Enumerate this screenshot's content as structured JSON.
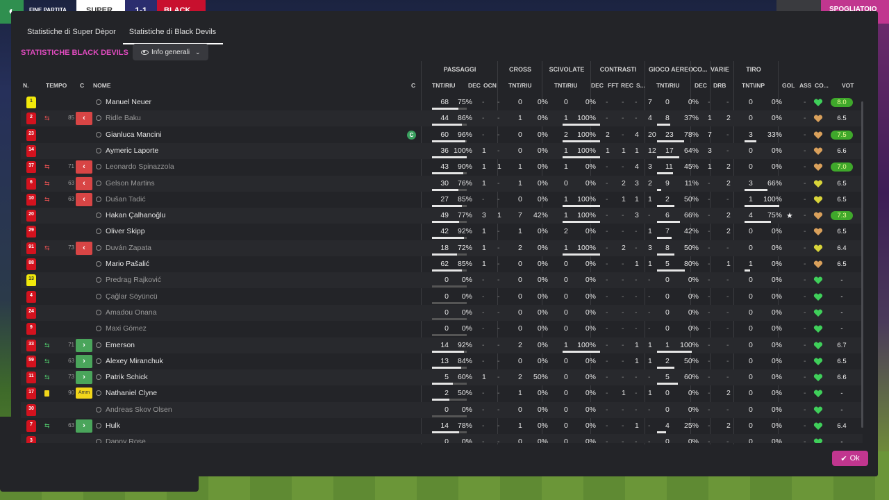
{
  "topbar": {
    "result_label": "FINE PARTITA",
    "team_home": "SUPER",
    "score": "1-1",
    "team_away": "BLACK",
    "dressing_room": "SPOGLIATOIO"
  },
  "tabs": [
    "Statistiche di Super Dèpor",
    "Statistiche di Black Devils"
  ],
  "section_title": "STATISTICHE BLACK DEVILS",
  "dropdown": "Info generali",
  "groups": [
    "PASSAGGI",
    "CROSS",
    "SCIVOLATE",
    "CONTRASTI",
    "GIOCO AEREO",
    "CO...",
    "VARIE",
    "TIRO"
  ],
  "cols": {
    "n": "N.",
    "tempo": "TEMPO",
    "c": "C",
    "nome": "NOME",
    "c2": "C",
    "pass": "TNT/RIU",
    "pdec": "DEC",
    "pocn": "OCN",
    "cross": "TNT/RIU",
    "sciv": "TNT/RIU",
    "cdec": "DEC",
    "cfft": "FFT",
    "crec": "REC",
    "cs": "S...",
    "aereo": "TNT/RIU",
    "codec": "DEC",
    "drb": "DRB",
    "tiro": "TNT\\INP",
    "gol": "GOL",
    "ass": "ASS",
    "co": "CO...",
    "vot": "VOT"
  },
  "players": [
    {
      "num": "1",
      "kit": "yellow",
      "name": "Manuel Neuer",
      "p": [
        "68",
        "75%"
      ],
      "pb": 0.75,
      "pd": "-",
      "po": "-",
      "c": [
        "0",
        "0%"
      ],
      "s": [
        "0",
        "0%"
      ],
      "cd": "-",
      "cf": "-",
      "cr": "-",
      "cs": "7",
      "a": [
        "0",
        "0%"
      ],
      "ad": "-",
      "dr": "-",
      "t": [
        "0",
        "0%"
      ],
      "gl": "",
      "as": "-",
      "mood": "green",
      "vot": "8.0",
      "vg": true
    },
    {
      "num": "2",
      "kit": "red",
      "sub": "out",
      "min": "85",
      "name": "Ridle Baku",
      "dim": true,
      "p": [
        "44",
        "86%"
      ],
      "pb": 0.86,
      "pd": "-",
      "po": "-",
      "c": [
        "1",
        "0%"
      ],
      "s": [
        "1",
        "100%"
      ],
      "cd": "-",
      "cf": "-",
      "cr": "-",
      "cs": "4",
      "a": [
        "8",
        "37%"
      ],
      "ad": "1",
      "dr": "2",
      "t": [
        "0",
        "0%"
      ],
      "gl": "",
      "as": "-",
      "mood": "orange",
      "vot": "6.5",
      "vg": false
    },
    {
      "num": "23",
      "kit": "red",
      "name": "Gianluca Mancini",
      "cap": true,
      "p": [
        "60",
        "96%"
      ],
      "pb": 0.96,
      "pd": "-",
      "po": "-",
      "c": [
        "0",
        "0%"
      ],
      "s": [
        "2",
        "100%"
      ],
      "cd": "2",
      "cf": "-",
      "cr": "4",
      "cs": "20",
      "a": [
        "23",
        "78%"
      ],
      "ad": "7",
      "dr": "-",
      "t": [
        "3",
        "33%"
      ],
      "gl": "",
      "as": "-",
      "mood": "orange",
      "vot": "7.5",
      "vg": true
    },
    {
      "num": "14",
      "kit": "red",
      "name": "Aymeric Laporte",
      "p": [
        "36",
        "100%"
      ],
      "pb": 1,
      "pd": "1",
      "po": "-",
      "c": [
        "0",
        "0%"
      ],
      "s": [
        "1",
        "100%"
      ],
      "cd": "1",
      "cf": "1",
      "cr": "1",
      "cs": "12",
      "a": [
        "17",
        "64%"
      ],
      "ad": "3",
      "dr": "-",
      "t": [
        "0",
        "0%"
      ],
      "gl": "",
      "as": "-",
      "mood": "orange",
      "vot": "6.6",
      "vg": false
    },
    {
      "num": "37",
      "kit": "red",
      "sub": "out",
      "min": "71",
      "name": "Leonardo Spinazzola",
      "dim": true,
      "p": [
        "43",
        "90%"
      ],
      "pb": 0.9,
      "pd": "1",
      "po": "1",
      "c": [
        "1",
        "0%"
      ],
      "s": [
        "1",
        "0%"
      ],
      "cd": "-",
      "cf": "-",
      "cr": "4",
      "cs": "3",
      "a": [
        "11",
        "45%"
      ],
      "ad": "1",
      "dr": "2",
      "t": [
        "0",
        "0%"
      ],
      "gl": "",
      "as": "-",
      "mood": "orange",
      "vot": "7.0",
      "vg": true
    },
    {
      "num": "6",
      "kit": "red",
      "sub": "out",
      "min": "63",
      "name": "Gelson Martins",
      "dim": true,
      "p": [
        "30",
        "76%"
      ],
      "pb": 0.76,
      "pd": "1",
      "po": "-",
      "c": [
        "1",
        "0%"
      ],
      "s": [
        "0",
        "0%"
      ],
      "cd": "-",
      "cf": "2",
      "cr": "3",
      "cs": "2",
      "a": [
        "9",
        "11%"
      ],
      "ad": "-",
      "dr": "2",
      "t": [
        "3",
        "66%"
      ],
      "gl": "",
      "as": "-",
      "mood": "yellow",
      "vot": "6.5",
      "vg": false
    },
    {
      "num": "10",
      "kit": "red",
      "sub": "out",
      "min": "63",
      "name": "Dušan Tadić",
      "dim": true,
      "p": [
        "27",
        "85%"
      ],
      "pb": 0.85,
      "pd": "-",
      "po": "-",
      "c": [
        "0",
        "0%"
      ],
      "s": [
        "1",
        "100%"
      ],
      "cd": "-",
      "cf": "1",
      "cr": "1",
      "cs": "1",
      "a": [
        "2",
        "50%"
      ],
      "ad": "-",
      "dr": "-",
      "t": [
        "1",
        "100%"
      ],
      "gl": "",
      "as": "-",
      "mood": "yellow",
      "vot": "6.5",
      "vg": false
    },
    {
      "num": "20",
      "kit": "red",
      "name": "Hakan Çalhanoğlu",
      "p": [
        "49",
        "77%"
      ],
      "pb": 0.77,
      "pd": "3",
      "po": "1",
      "c": [
        "7",
        "42%"
      ],
      "s": [
        "1",
        "100%"
      ],
      "cd": "-",
      "cf": "-",
      "cr": "3",
      "cs": "-",
      "a": [
        "6",
        "66%"
      ],
      "ad": "-",
      "dr": "2",
      "t": [
        "4",
        "75%"
      ],
      "gl": "★",
      "as": "-",
      "mood": "orange",
      "vot": "7.3",
      "vg": true
    },
    {
      "num": "29",
      "kit": "red",
      "name": "Oliver Skipp",
      "p": [
        "42",
        "92%"
      ],
      "pb": 0.92,
      "pd": "1",
      "po": "-",
      "c": [
        "1",
        "0%"
      ],
      "s": [
        "2",
        "0%"
      ],
      "cd": "-",
      "cf": "-",
      "cr": "-",
      "cs": "1",
      "a": [
        "7",
        "42%"
      ],
      "ad": "-",
      "dr": "2",
      "t": [
        "0",
        "0%"
      ],
      "gl": "",
      "as": "-",
      "mood": "orange",
      "vot": "6.5",
      "vg": false
    },
    {
      "num": "91",
      "kit": "red",
      "sub": "out",
      "min": "73",
      "name": "Duván Zapata",
      "dim": true,
      "p": [
        "18",
        "72%"
      ],
      "pb": 0.72,
      "pd": "1",
      "po": "-",
      "c": [
        "2",
        "0%"
      ],
      "s": [
        "1",
        "100%"
      ],
      "cd": "-",
      "cf": "2",
      "cr": "-",
      "cs": "3",
      "a": [
        "8",
        "50%"
      ],
      "ad": "-",
      "dr": "-",
      "t": [
        "0",
        "0%"
      ],
      "gl": "",
      "as": "-",
      "mood": "yellow",
      "vot": "6.4",
      "vg": false
    },
    {
      "num": "88",
      "kit": "red",
      "name": "Mario Pašalić",
      "p": [
        "62",
        "85%"
      ],
      "pb": 0.85,
      "pd": "1",
      "po": "-",
      "c": [
        "0",
        "0%"
      ],
      "s": [
        "0",
        "0%"
      ],
      "cd": "-",
      "cf": "-",
      "cr": "1",
      "cs": "1",
      "a": [
        "5",
        "80%"
      ],
      "ad": "-",
      "dr": "1",
      "t": [
        "1",
        "0%"
      ],
      "gl": "",
      "as": "-",
      "mood": "orange",
      "vot": "6.5",
      "vg": false
    },
    {
      "num": "13",
      "kit": "yellow",
      "name": "Predrag Rajković",
      "dim": true,
      "p": [
        "0",
        "0%"
      ],
      "pb": 0,
      "pd": "-",
      "po": "-",
      "c": [
        "0",
        "0%"
      ],
      "s": [
        "0",
        "0%"
      ],
      "cd": "-",
      "cf": "-",
      "cr": "-",
      "cs": "-",
      "a": [
        "0",
        "0%"
      ],
      "ad": "-",
      "dr": "-",
      "t": [
        "0",
        "0%"
      ],
      "gl": "",
      "as": "-",
      "mood": "green",
      "vot": "-",
      "vg": false
    },
    {
      "num": "4",
      "kit": "red",
      "name": "Çağlar Söyüncü",
      "dim": true,
      "p": [
        "0",
        "0%"
      ],
      "pb": 0,
      "pd": "-",
      "po": "-",
      "c": [
        "0",
        "0%"
      ],
      "s": [
        "0",
        "0%"
      ],
      "cd": "-",
      "cf": "-",
      "cr": "-",
      "cs": "-",
      "a": [
        "0",
        "0%"
      ],
      "ad": "-",
      "dr": "-",
      "t": [
        "0",
        "0%"
      ],
      "gl": "",
      "as": "-",
      "mood": "green",
      "vot": "-",
      "vg": false
    },
    {
      "num": "24",
      "kit": "red",
      "name": "Amadou Onana",
      "dim": true,
      "p": [
        "0",
        "0%"
      ],
      "pb": 0,
      "pd": "-",
      "po": "-",
      "c": [
        "0",
        "0%"
      ],
      "s": [
        "0",
        "0%"
      ],
      "cd": "-",
      "cf": "-",
      "cr": "-",
      "cs": "-",
      "a": [
        "0",
        "0%"
      ],
      "ad": "-",
      "dr": "-",
      "t": [
        "0",
        "0%"
      ],
      "gl": "",
      "as": "-",
      "mood": "green",
      "vot": "-",
      "vg": false
    },
    {
      "num": "9",
      "kit": "red",
      "name": "Maxi Gómez",
      "dim": true,
      "p": [
        "0",
        "0%"
      ],
      "pb": 0,
      "pd": "-",
      "po": "-",
      "c": [
        "0",
        "0%"
      ],
      "s": [
        "0",
        "0%"
      ],
      "cd": "-",
      "cf": "-",
      "cr": "-",
      "cs": "-",
      "a": [
        "0",
        "0%"
      ],
      "ad": "-",
      "dr": "-",
      "t": [
        "0",
        "0%"
      ],
      "gl": "",
      "as": "-",
      "mood": "green",
      "vot": "-",
      "vg": false
    },
    {
      "num": "33",
      "kit": "red",
      "sub": "in",
      "min": "71",
      "name": "Emerson",
      "p": [
        "14",
        "92%"
      ],
      "pb": 0.92,
      "pd": "-",
      "po": "-",
      "c": [
        "2",
        "0%"
      ],
      "s": [
        "1",
        "100%"
      ],
      "cd": "-",
      "cf": "-",
      "cr": "1",
      "cs": "1",
      "a": [
        "1",
        "100%"
      ],
      "ad": "-",
      "dr": "-",
      "t": [
        "0",
        "0%"
      ],
      "gl": "",
      "as": "-",
      "mood": "green",
      "vot": "6.7",
      "vg": false
    },
    {
      "num": "59",
      "kit": "red",
      "sub": "in",
      "min": "63",
      "name": "Alexey Miranchuk",
      "p": [
        "13",
        "84%"
      ],
      "pb": 0.84,
      "pd": "-",
      "po": "-",
      "c": [
        "0",
        "0%"
      ],
      "s": [
        "0",
        "0%"
      ],
      "cd": "-",
      "cf": "-",
      "cr": "1",
      "cs": "1",
      "a": [
        "2",
        "50%"
      ],
      "ad": "-",
      "dr": "-",
      "t": [
        "0",
        "0%"
      ],
      "gl": "",
      "as": "-",
      "mood": "green",
      "vot": "6.5",
      "vg": false
    },
    {
      "num": "11",
      "kit": "red",
      "sub": "in",
      "min": "73",
      "name": "Patrik Schick",
      "p": [
        "5",
        "60%"
      ],
      "pb": 0.6,
      "pd": "1",
      "po": "-",
      "c": [
        "2",
        "50%"
      ],
      "s": [
        "0",
        "0%"
      ],
      "cd": "-",
      "cf": "-",
      "cr": "-",
      "cs": "-",
      "a": [
        "5",
        "60%"
      ],
      "ad": "-",
      "dr": "-",
      "t": [
        "0",
        "0%"
      ],
      "gl": "",
      "as": "-",
      "mood": "green",
      "vot": "6.6",
      "vg": false
    },
    {
      "num": "17",
      "kit": "red",
      "card": true,
      "min": "90",
      "amm": "Amm",
      "name": "Nathaniel Clyne",
      "p": [
        "2",
        "50%"
      ],
      "pb": 0.5,
      "pd": "-",
      "po": "-",
      "c": [
        "1",
        "0%"
      ],
      "s": [
        "0",
        "0%"
      ],
      "cd": "-",
      "cf": "1",
      "cr": "-",
      "cs": "1",
      "a": [
        "0",
        "0%"
      ],
      "ad": "-",
      "dr": "2",
      "t": [
        "0",
        "0%"
      ],
      "gl": "",
      "as": "-",
      "mood": "green",
      "vot": "-",
      "vg": false
    },
    {
      "num": "30",
      "kit": "red",
      "name": "Andreas Skov Olsen",
      "dim": true,
      "p": [
        "0",
        "0%"
      ],
      "pb": 0,
      "pd": "-",
      "po": "-",
      "c": [
        "0",
        "0%"
      ],
      "s": [
        "0",
        "0%"
      ],
      "cd": "-",
      "cf": "-",
      "cr": "-",
      "cs": "-",
      "a": [
        "0",
        "0%"
      ],
      "ad": "-",
      "dr": "-",
      "t": [
        "0",
        "0%"
      ],
      "gl": "",
      "as": "-",
      "mood": "green",
      "vot": "-",
      "vg": false
    },
    {
      "num": "7",
      "kit": "red",
      "sub": "in",
      "min": "63",
      "name": "Hulk",
      "p": [
        "14",
        "78%"
      ],
      "pb": 0.78,
      "pd": "-",
      "po": "-",
      "c": [
        "1",
        "0%"
      ],
      "s": [
        "0",
        "0%"
      ],
      "cd": "-",
      "cf": "-",
      "cr": "1",
      "cs": "-",
      "a": [
        "4",
        "25%"
      ],
      "ad": "-",
      "dr": "2",
      "t": [
        "0",
        "0%"
      ],
      "gl": "",
      "as": "-",
      "mood": "green",
      "vot": "6.4",
      "vg": false
    },
    {
      "num": "3",
      "kit": "red",
      "name": "Danny Rose",
      "dim": true,
      "p": [
        "0",
        "0%"
      ],
      "pb": 0,
      "pd": "-",
      "po": "-",
      "c": [
        "0",
        "0%"
      ],
      "s": [
        "0",
        "0%"
      ],
      "cd": "-",
      "cf": "-",
      "cr": "-",
      "cs": "-",
      "a": [
        "0",
        "0%"
      ],
      "ad": "-",
      "dr": "-",
      "t": [
        "0",
        "0%"
      ],
      "gl": "",
      "as": "-",
      "mood": "green",
      "vot": "-",
      "vg": false
    }
  ],
  "ok_label": "Ok",
  "colors": {
    "accent": "#c1368f",
    "title": "#e04bbf",
    "green": "#3fa82b",
    "red_kit": "#d3121e",
    "yellow_kit": "#f1e90b",
    "mood_green": "#3fcf5a",
    "mood_orange": "#d9a05b",
    "mood_yellow": "#d8d43a"
  }
}
